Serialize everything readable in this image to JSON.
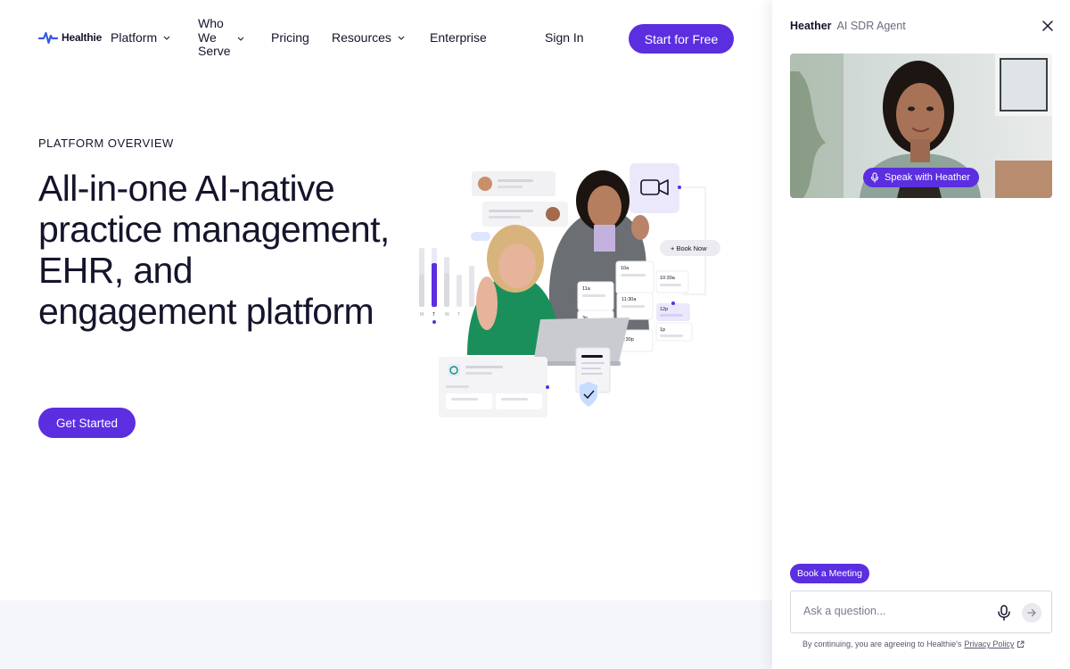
{
  "brand": {
    "name": "Healthie",
    "accent": "#5b2ee0",
    "text_color": "#14142b"
  },
  "nav": {
    "items": [
      {
        "label": "Platform",
        "has_dropdown": true
      },
      {
        "label": "Who We Serve",
        "has_dropdown": true
      },
      {
        "label": "Pricing",
        "has_dropdown": false
      },
      {
        "label": "Resources",
        "has_dropdown": true
      },
      {
        "label": "Enterprise",
        "has_dropdown": false
      }
    ],
    "who_lines": [
      "Who",
      "We",
      "Serve"
    ],
    "sign_in": "Sign In",
    "cta": "Start for Free"
  },
  "hero": {
    "eyebrow": "PLATFORM OVERVIEW",
    "title": "All-in-one AI-native practice management, EHR, and engagement platform",
    "cta": "Get Started",
    "art": {
      "book_now": "+ Book Now",
      "weekdays": [
        "M",
        "T",
        "W",
        "T"
      ],
      "slots": [
        "10a",
        "11a",
        "11:30a",
        "10:30a",
        "12p",
        "1p",
        "1:30p",
        "3p"
      ],
      "bar_levels": [
        0.45,
        0.75,
        0.55,
        0.35,
        0.6
      ]
    }
  },
  "chat": {
    "agent_name": "Heather",
    "agent_role": "AI SDR Agent",
    "speak_label": "Speak with Heather",
    "book_meeting": "Book a Meeting",
    "input_placeholder": "Ask a question...",
    "consent_text": "By continuing, you are agreeing to Healthie's",
    "privacy_link": "Privacy Policy"
  },
  "icons": {
    "close": "close-icon",
    "mic": "microphone-icon",
    "send": "arrow-right-icon",
    "external": "external-link-icon",
    "video": "video-camera-icon",
    "shield": "shield-check-icon",
    "chevron": "chevron-down-icon"
  }
}
